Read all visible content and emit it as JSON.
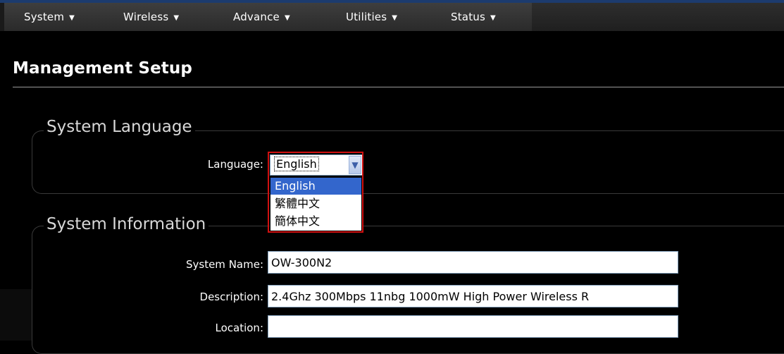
{
  "menu": {
    "items": [
      {
        "label": "System"
      },
      {
        "label": "Wireless"
      },
      {
        "label": "Advance"
      },
      {
        "label": "Utilities"
      },
      {
        "label": "Status"
      }
    ],
    "arrow_icon": "chevron-down-icon"
  },
  "page": {
    "title": "Management Setup"
  },
  "language_section": {
    "legend": "System Language",
    "language_label": "Language:",
    "selected": "English",
    "options": [
      "English",
      "繁體中文",
      "簡体中文"
    ],
    "highlight_color": "#d01010"
  },
  "info_section": {
    "legend": "System Information",
    "system_name_label": "System Name:",
    "system_name_value": "OW-300N2",
    "description_label": "Description:",
    "description_value": "2.4Ghz 300Mbps 11nbg 1000mW High Power Wireless R",
    "location_label": "Location:",
    "location_value": ""
  },
  "colors": {
    "background": "#000000",
    "menubar": "#333333",
    "selection": "#3366cc",
    "top_accent": "#1c3b6e"
  }
}
